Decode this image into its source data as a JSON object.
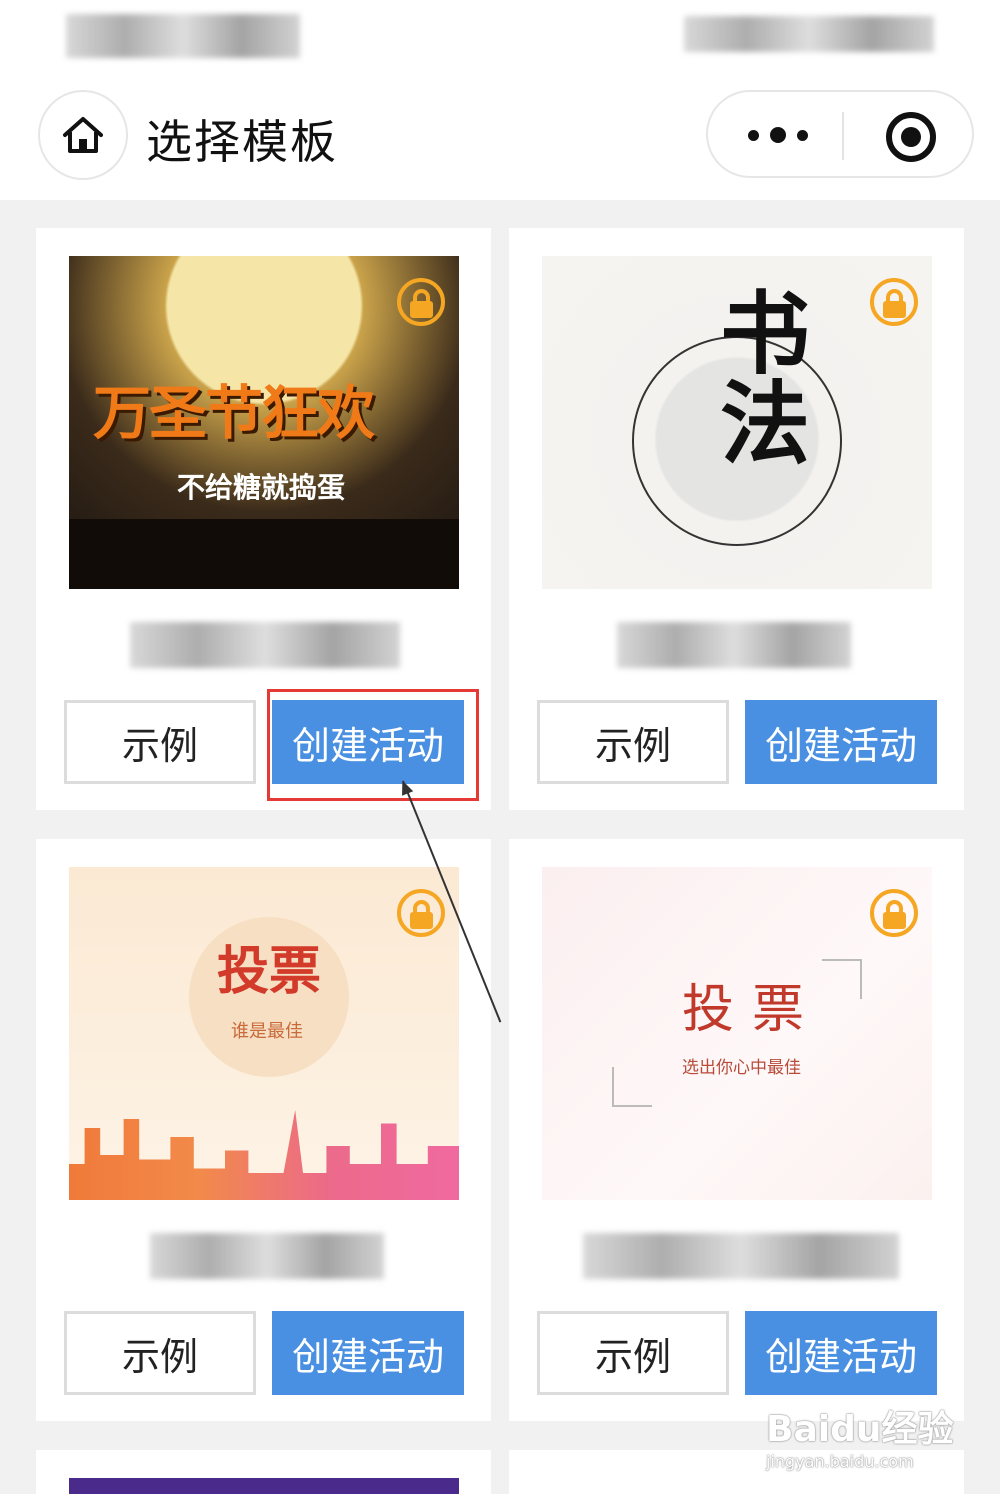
{
  "nav": {
    "title": "选择模板"
  },
  "icons": {
    "home": "home-icon",
    "more": "more-dots-icon",
    "close": "target-circle-icon",
    "lock": "lock-icon"
  },
  "cards": [
    {
      "thumb_title": "万圣节狂欢",
      "thumb_subtitle": "不给糖就捣蛋",
      "demo_label": "示例",
      "create_label": "创建活动"
    },
    {
      "thumb_title": "书法",
      "demo_label": "示例",
      "create_label": "创建活动"
    },
    {
      "thumb_title": "投票",
      "thumb_subtitle": "谁是最佳",
      "demo_label": "示例",
      "create_label": "创建活动"
    },
    {
      "thumb_title": "投票",
      "thumb_subtitle": "选出你心中最佳",
      "demo_label": "示例",
      "create_label": "创建活动"
    }
  ],
  "watermark": {
    "brand": "Baidu经验",
    "url": "jingyan.baidu.com"
  },
  "colors": {
    "primary": "#4a90e2",
    "lock": "#f5a623",
    "highlight": "#e53935"
  }
}
